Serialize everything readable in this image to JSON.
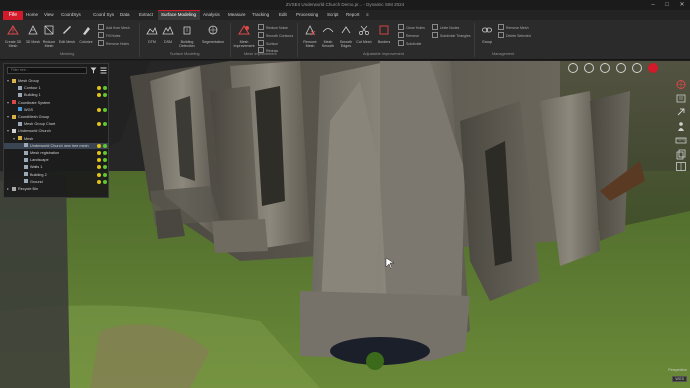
{
  "window": {
    "title": "ZVSE4 Underworld Church Demo.pr... - Dynamic SIM 2024",
    "controls": {
      "minimize": "–",
      "maximize": "□",
      "close": "✕"
    }
  },
  "menu": {
    "file": "File",
    "tabs": [
      "Home",
      "View",
      "CoordSys",
      "Coord Sys",
      "Data",
      "Extract",
      "Surface Modeling",
      "Analysis",
      "Measure",
      "Tracking",
      "Edit",
      "Processing",
      "Script",
      "Report"
    ],
    "active_tab": "Surface Modeling",
    "overflow": "≡"
  },
  "ribbon": {
    "groups": [
      {
        "name": "Meshing",
        "items": [
          "Create 3D Mesh",
          "3D Mesh",
          "Reduce Mesh",
          "Edit Mesh",
          "Colorize"
        ],
        "small": [
          "Add from Mesh",
          "Fill Holes",
          "Remove Holes"
        ]
      },
      {
        "name": "Surface Modeling",
        "items": [
          "DTM",
          "DSM",
          "Building Detection",
          "Segmentation"
        ]
      },
      {
        "name": "Mesh Improvement",
        "items": [
          "Mesh Improvement"
        ],
        "small": [
          "Reduce Noise",
          "Smooth Contours",
          "Surface",
          "Redraw"
        ]
      },
      {
        "name": "Adjustable Improvement",
        "items": [
          "Remove Mesh",
          "Mesh Smooth",
          "Smooth Edges",
          "Cut Mesh",
          "Borders"
        ],
        "small": [
          "Close Holes",
          "Remove",
          "Subdivide",
          "Unite Nodes",
          "Subdivide Triangles"
        ]
      },
      {
        "name": "Management",
        "items": [
          "Group"
        ],
        "small": [
          "Remove Mesh",
          "Delete Selected"
        ]
      }
    ]
  },
  "scene_panel": {
    "search_placeholder": "Filter tree...",
    "tree": [
      {
        "label": "Mesh Group",
        "level": 0,
        "icon": "folder-icon",
        "expanded": true
      },
      {
        "label": "Contour 1",
        "level": 1,
        "icon": "mesh-icon",
        "status": "green"
      },
      {
        "label": "Building 1",
        "level": 1,
        "icon": "mesh-icon",
        "status": "green"
      },
      {
        "label": "Coordinate System",
        "level": 0,
        "icon": "axis-icon",
        "expanded": true
      },
      {
        "label": "WGS",
        "level": 1,
        "icon": "globe-icon",
        "status": "green"
      },
      {
        "label": "CoordMesh Group",
        "level": 0,
        "icon": "folder-icon",
        "expanded": true
      },
      {
        "label": "Mesh Group Chart",
        "level": 1,
        "icon": "mesh-icon",
        "status": "green"
      },
      {
        "label": "Underworld Church",
        "level": 0,
        "icon": "scene-icon",
        "expanded": true
      },
      {
        "label": "Mesh",
        "level": 1,
        "icon": "folder-icon",
        "expanded": true
      },
      {
        "label": "Underworld Church new tree mesh",
        "level": 2,
        "icon": "mesh-icon",
        "status": "green",
        "selected": true
      },
      {
        "label": "Mesh registration",
        "level": 2,
        "icon": "mesh-icon",
        "status": "green"
      },
      {
        "label": "Landscape",
        "level": 2,
        "icon": "mesh-icon",
        "status": "green"
      },
      {
        "label": "Walls 1",
        "level": 2,
        "icon": "mesh-icon",
        "status": "green"
      },
      {
        "label": "Building 2",
        "level": 2,
        "icon": "mesh-icon",
        "status": "green"
      },
      {
        "label": "Ground",
        "level": 2,
        "icon": "mesh-icon",
        "status": "green"
      },
      {
        "label": "Recycle Bin",
        "level": 0,
        "icon": "trash-icon",
        "expanded": false
      }
    ]
  },
  "status": {
    "coordinate": "Perspective",
    "zoom": "WGS"
  },
  "colors": {
    "accent": "#d21a2a",
    "panel": "#1c1c1c",
    "ribbon": "#2b2b2b",
    "status_green": "#5fc82a"
  }
}
